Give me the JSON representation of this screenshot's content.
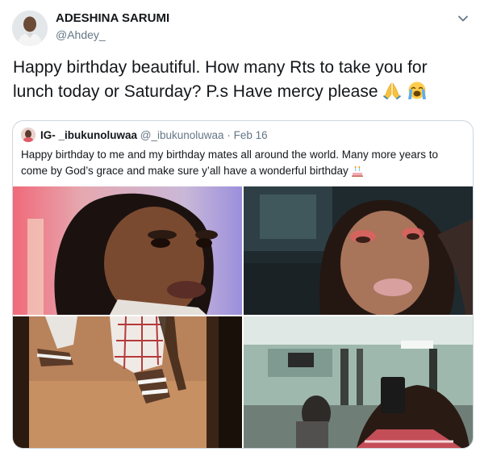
{
  "tweet": {
    "author_name": "ADESHINA SARUMI",
    "author_handle": "@Ahdey_",
    "text": "Happy birthday beautiful. How many Rts to take you for lunch today or Saturday? P.s Have mercy please",
    "emojis": [
      "folded-hands",
      "loudly-crying-face"
    ]
  },
  "quoted_tweet": {
    "author_name": "IG- _ibukunoluwaa",
    "author_handle": "@_ibukunoluwaa",
    "separator": "·",
    "date": "Feb 16",
    "text": "Happy birthday to me and my birthday mates all around the world. Many more years to come by God’s grace and make sure y’all have a wonderful birthday",
    "emoji": "birthday-cake",
    "photos": [
      "selfie-portrait-1",
      "selfie-portrait-2",
      "feet-in-sandals",
      "gym-mirror-selfie"
    ]
  },
  "icons": {
    "menu": "chevron-down-icon"
  }
}
